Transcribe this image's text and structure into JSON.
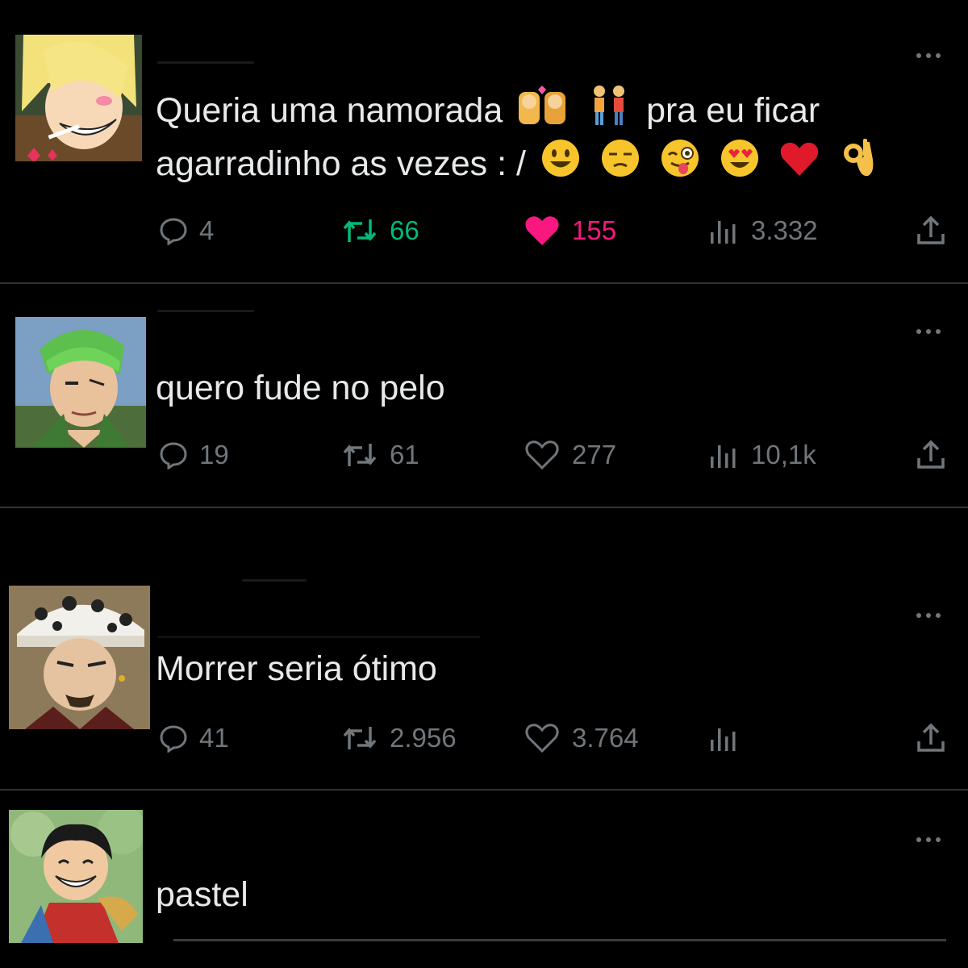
{
  "tweets": [
    {
      "text_line1": "Queria uma namorada",
      "text_line1_after": "pra eu ficar",
      "text_line2": "agarradinho as vezes : /",
      "reply_count": "4",
      "retweet_count": "66",
      "like_count": "155",
      "views_count": "3.332",
      "liked": true,
      "retweeted": true
    },
    {
      "text": "quero fude no pelo",
      "reply_count": "19",
      "retweet_count": "61",
      "like_count": "277",
      "views_count": "10,1k"
    },
    {
      "text": "Morrer seria ótimo",
      "reply_count": "41",
      "retweet_count": "2.956",
      "like_count": "3.764",
      "views_count": ""
    },
    {
      "text": "pastel"
    }
  ],
  "colors": {
    "background": "#000000",
    "text": "#e7e9ea",
    "muted": "#71767b",
    "retweet_active": "#00ba7c",
    "like_active": "#f91880",
    "divider": "#2f3336"
  },
  "icons": [
    "reply-icon",
    "retweet-icon",
    "like-icon",
    "views-icon",
    "share-icon",
    "more-icon"
  ]
}
